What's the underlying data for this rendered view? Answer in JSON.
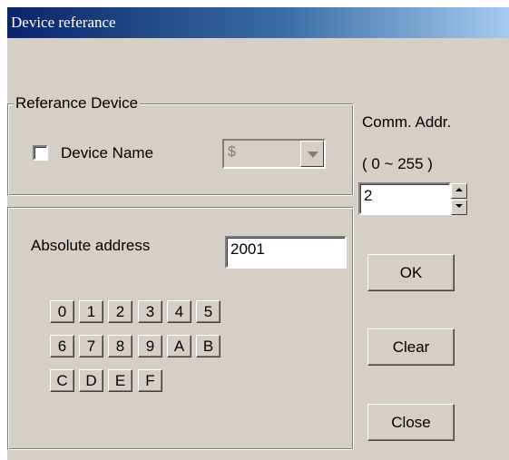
{
  "window": {
    "title": "Device referance"
  },
  "reference_group": {
    "legend": "Referance Device",
    "checkbox_label": "Device Name",
    "checkbox_checked": false,
    "combo_value": "$",
    "combo_enabled": false
  },
  "comm": {
    "label": "Comm. Addr.",
    "range": "( 0 ~ 255 )",
    "value": "2"
  },
  "address": {
    "label": "Absolute address",
    "value": "2001"
  },
  "keypad": {
    "row1": [
      "0",
      "1",
      "2",
      "3",
      "4",
      "5"
    ],
    "row2": [
      "6",
      "7",
      "8",
      "9",
      "A",
      "B"
    ],
    "row3": [
      "C",
      "D",
      "E",
      "F"
    ]
  },
  "buttons": {
    "ok": "OK",
    "clear": "Clear",
    "close": "Close"
  }
}
